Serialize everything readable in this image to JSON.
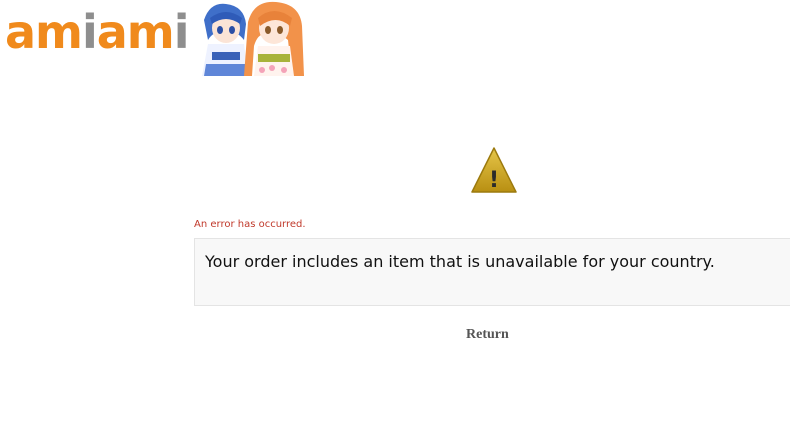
{
  "header": {
    "logo_part1": "am",
    "logo_part2": "i",
    "logo_part3": "am",
    "logo_part4": "i",
    "mascot_icon": "mascot-characters-icon"
  },
  "warning": {
    "icon": "warning-triangle-icon",
    "symbol": "!"
  },
  "error": {
    "label": "An error has occurred.",
    "message": "Your order includes an item that is unavailable for your country."
  },
  "actions": {
    "return_label": "Return"
  },
  "colors": {
    "logo_orange": "#f08a1c",
    "logo_gray": "#8e8e8e",
    "error_red": "#c0392b",
    "warning_gold": "#c9a01c"
  }
}
